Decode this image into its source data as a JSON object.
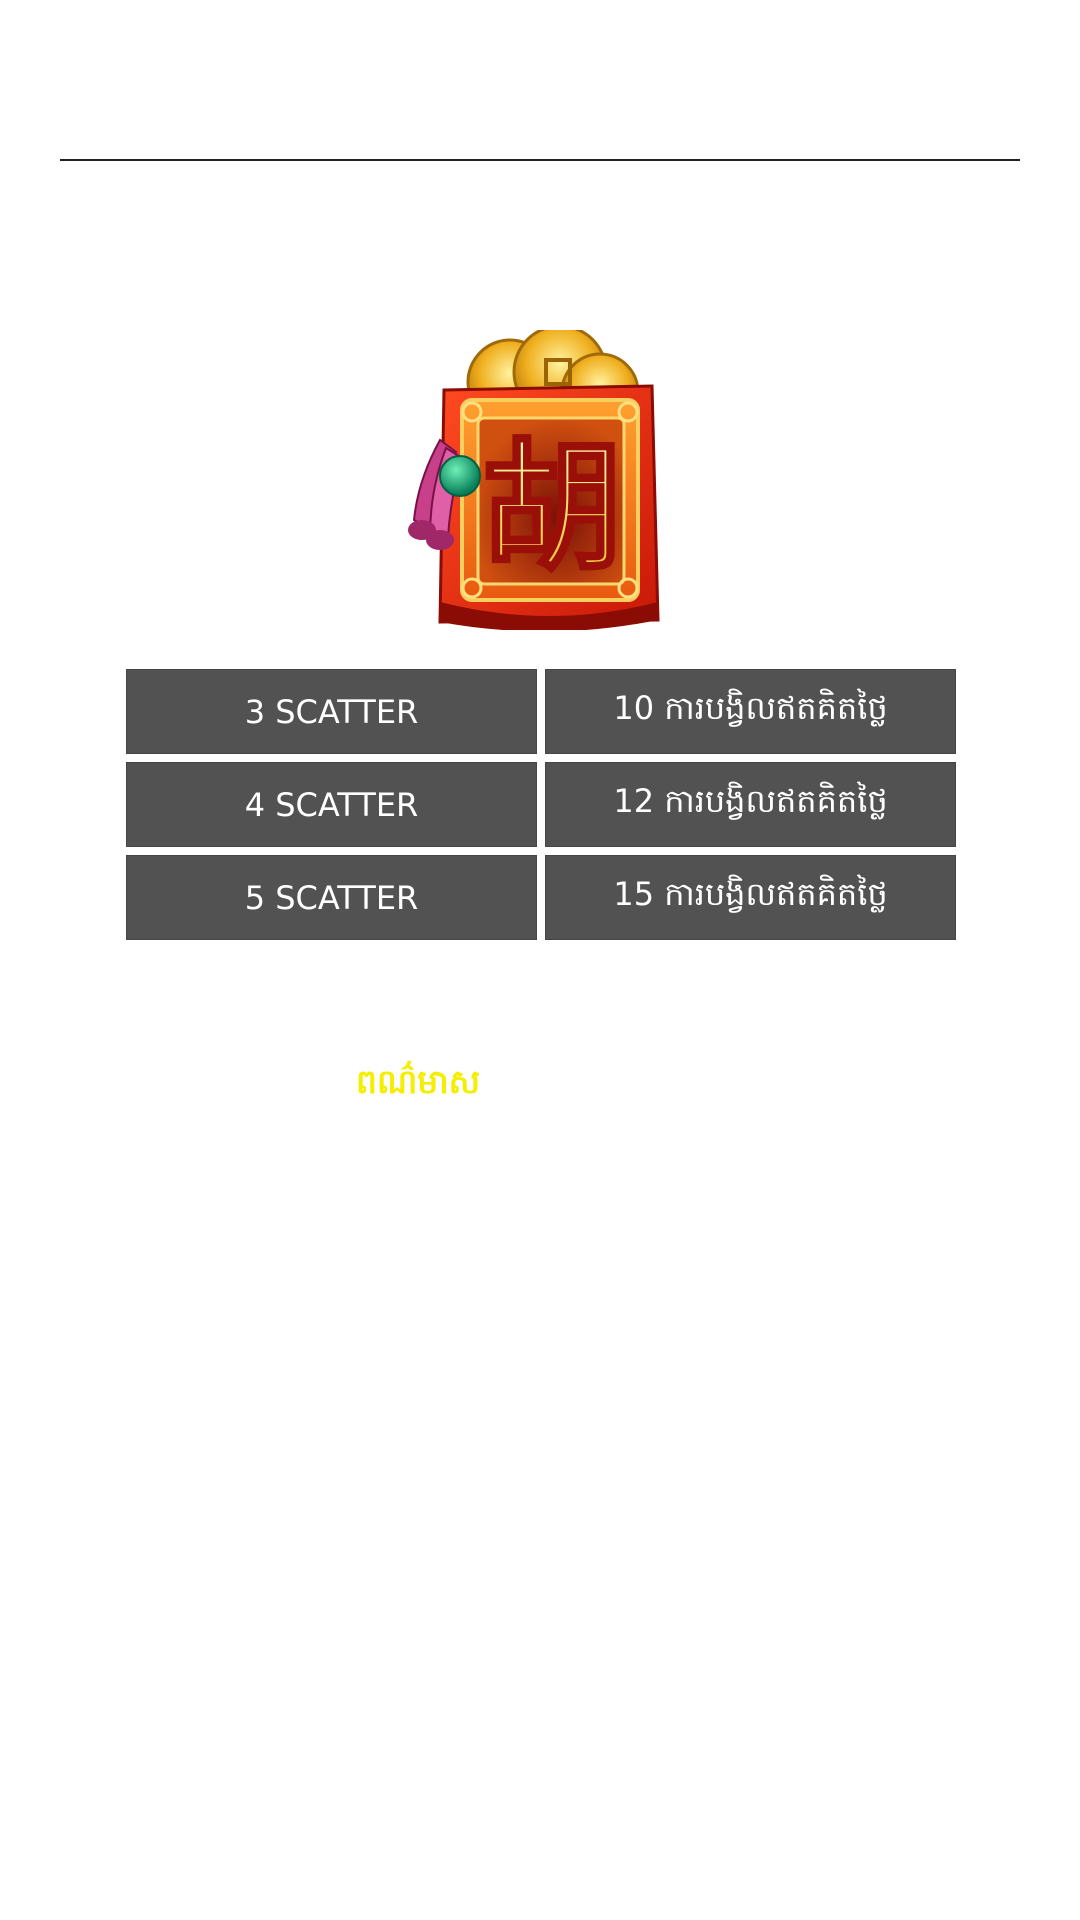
{
  "scatter_symbol": {
    "icon": "red-envelope-scatter-icon",
    "glyph": "胡"
  },
  "paytable": {
    "rows": [
      {
        "count": "3 SCATTER",
        "award": "10 ការបង្វិលឥតគិតថ្លៃ"
      },
      {
        "count": "4 SCATTER",
        "award": "12 ការបង្វិលឥតគិតថ្លៃ"
      },
      {
        "count": "5 SCATTER",
        "award": "15 ការបង្វិលឥតគិតថ្លៃ"
      }
    ]
  },
  "feature": {
    "label": "ពណ៌មាស",
    "color": "#f4ee00"
  },
  "colors": {
    "cell_bg": "#525252",
    "cell_text": "#ffffff",
    "rule": "#222222"
  }
}
